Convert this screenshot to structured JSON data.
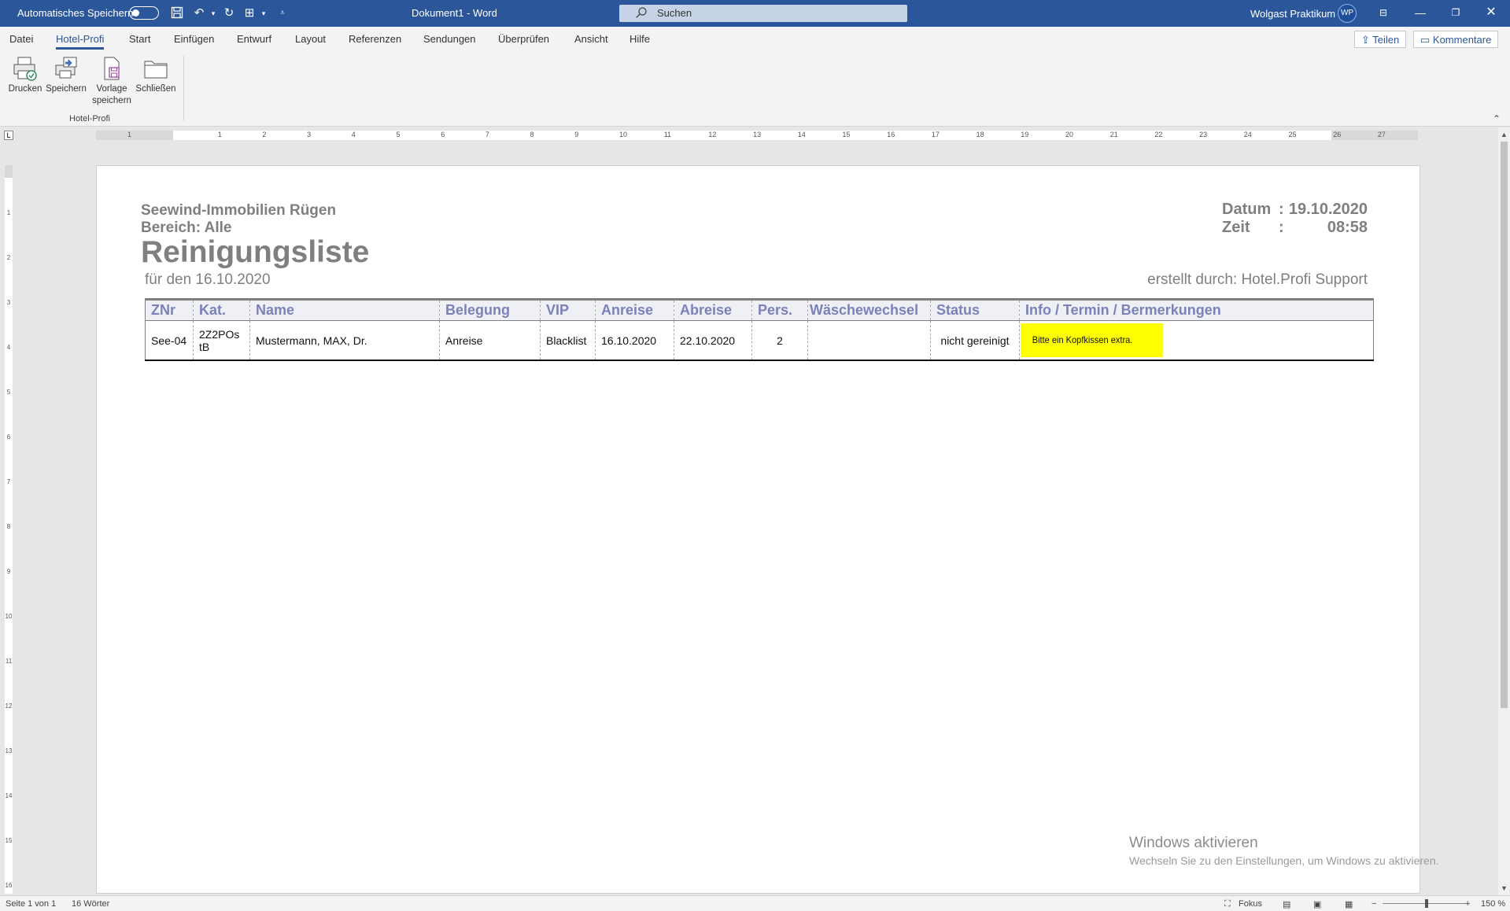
{
  "titlebar": {
    "autosave_label": "Automatisches Speichern",
    "doc_title": "Dokument1  -  Word",
    "search_placeholder": "Suchen",
    "user_name": "Wolgast Praktikum",
    "user_initials": "WP"
  },
  "tabs": [
    "Datei",
    "Hotel-Profi",
    "Start",
    "Einfügen",
    "Entwurf",
    "Layout",
    "Referenzen",
    "Sendungen",
    "Überprüfen",
    "Ansicht",
    "Hilfe"
  ],
  "active_tab": "Hotel-Profi",
  "share_label": "Teilen",
  "comments_label": "Kommentare",
  "ribbon": {
    "buttons": [
      {
        "label": "Drucken",
        "icon": "print-icon"
      },
      {
        "label": "Speichern",
        "icon": "save-icon"
      },
      {
        "label": "Vorlage speichern",
        "icon": "save-template-icon"
      },
      {
        "label": "Schließen",
        "icon": "folder-icon"
      }
    ],
    "group_label": "Hotel-Profi"
  },
  "ruler": {
    "h_numbers": [
      "1",
      "1",
      "2",
      "3",
      "4",
      "5",
      "6",
      "7",
      "8",
      "9",
      "10",
      "11",
      "12",
      "13",
      "14",
      "15",
      "16",
      "17",
      "18",
      "19",
      "20",
      "21",
      "22",
      "23",
      "24",
      "25",
      "26",
      "27"
    ],
    "v_numbers": [
      "1",
      "2",
      "3",
      "4",
      "5",
      "6",
      "7",
      "8",
      "9",
      "10",
      "11",
      "12",
      "13",
      "14",
      "15",
      "16"
    ]
  },
  "document": {
    "company": "Seewind-Immobilien Rügen",
    "bereich": "Bereich: Alle",
    "heading": "Reinigungsliste",
    "for_date": "für den 16.10.2020",
    "datum_label": "Datum",
    "datum_value": "19.10.2020",
    "zeit_label": "Zeit",
    "zeit_value": "08:58",
    "colon": ":",
    "created_by": "erstellt durch: Hotel.Profi Support",
    "table": {
      "headers": [
        "ZNr",
        "Kat.",
        "Name",
        "Belegung",
        "VIP",
        "Anreise",
        "Abreise",
        "Pers.",
        "Wäschewechsel",
        "Status",
        "Info / Termin / Bermerkungen"
      ],
      "rows": [
        {
          "znr": "See-04",
          "kat": "2Z2POs tB",
          "name": "Mustermann, MAX, Dr.",
          "belegung": "Anreise",
          "vip": "Blacklist",
          "anreise": "16.10.2020",
          "abreise": "22.10.2020",
          "pers": "2",
          "waeschewechsel": "",
          "status": "nicht gereinigt",
          "info": "Bitte ein Kopfkissen extra."
        }
      ]
    }
  },
  "watermark": {
    "title": "Windows aktivieren",
    "subtitle": "Wechseln Sie zu den Einstellungen, um Windows zu aktivieren."
  },
  "statusbar": {
    "page": "Seite 1 von 1",
    "words": "16 Wörter",
    "focus": "Fokus",
    "zoom": "150 %"
  },
  "colors": {
    "titlebar": "#2b579a",
    "header_text": "#7b82b8",
    "highlight": "#ffff00",
    "gray_text": "#7f7f7f"
  }
}
